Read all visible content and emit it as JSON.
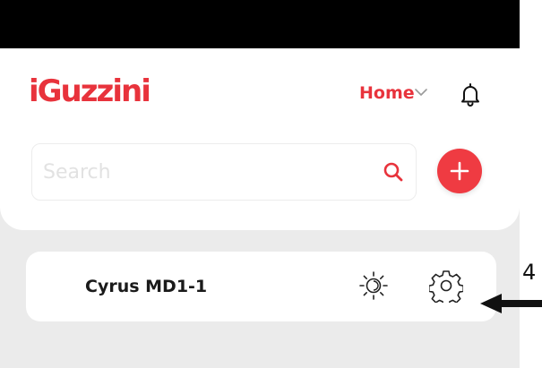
{
  "header": {
    "logo_text": "iGuzzini",
    "nav_home_label": "Home",
    "icons": [
      "chevron-down-icon",
      "bell-icon"
    ]
  },
  "search": {
    "value": "",
    "placeholder": "Search"
  },
  "actions": {
    "add_icon": "plus-icon"
  },
  "devices": [
    {
      "name": "Cyrus MD1-1",
      "icons": [
        "brightness-icon",
        "gear-icon"
      ]
    }
  ],
  "annotation": {
    "label": "4"
  },
  "colors": {
    "brand": "#e8333c",
    "background": "#ebebeb",
    "card": "#ffffff",
    "text": "#1a1a1a"
  }
}
